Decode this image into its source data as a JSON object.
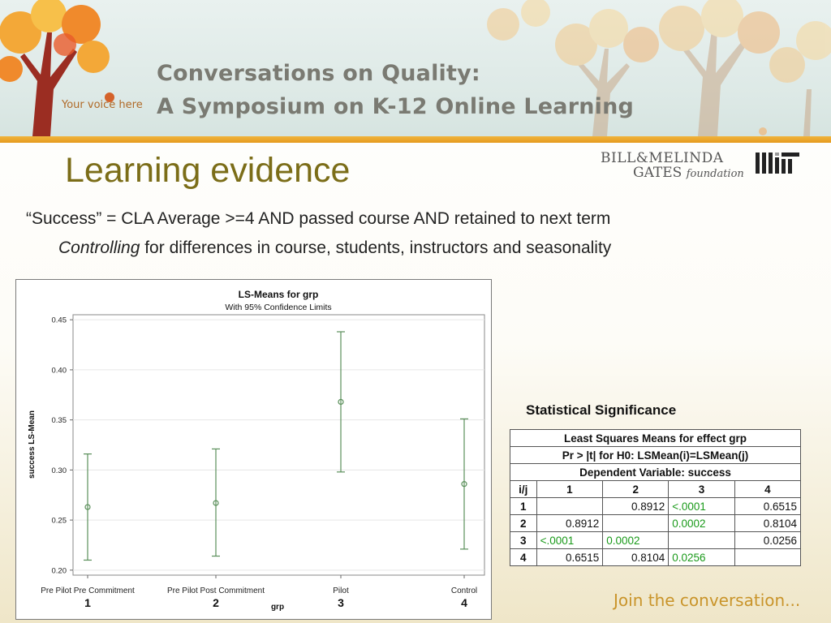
{
  "banner": {
    "title_line1": "Conversations on Quality:",
    "title_line2": "A Symposium on K-12 Online Learning",
    "voice": "Your voice here"
  },
  "slide": {
    "title": "Learning evidence",
    "line1": "“Success” = CLA Average >=4 AND passed course AND retained to next term",
    "line2_italic": "Controlling",
    "line2_rest": " for differences in course, students, instructors and seasonality"
  },
  "logos": {
    "gates_line1": "BILL&MELINDA",
    "gates_line2_a": "GATES",
    "gates_line2_b": "foundation",
    "mit": "MIT"
  },
  "chart_data": {
    "type": "scatter",
    "title": "LS-Means for grp",
    "subtitle": "With 95% Confidence Limits",
    "xlabel": "grp",
    "ylabel": "success LS-Mean",
    "ylim": [
      0.195,
      0.455
    ],
    "yticks": [
      "0.20",
      "0.25",
      "0.30",
      "0.35",
      "0.40",
      "0.45"
    ],
    "categories": [
      "Pre Pilot Pre Commitment",
      "Pre Pilot Post Commitment",
      "Pilot",
      "Control"
    ],
    "group_numbers": [
      "1",
      "2",
      "3",
      "4"
    ],
    "series": [
      {
        "values": [
          0.263,
          0.267,
          0.368,
          0.286
        ],
        "lower": [
          0.21,
          0.214,
          0.298,
          0.221
        ],
        "upper": [
          0.316,
          0.321,
          0.438,
          0.351
        ]
      }
    ],
    "color": "#5a8f5a",
    "grid": true
  },
  "table": {
    "heading": "Statistical Significance",
    "title1": "Least Squares Means for effect grp",
    "title2": "Pr > |t| for H0: LSMean(i)=LSMean(j)",
    "title3": "Dependent Variable: success",
    "corner": "i/j",
    "columns": [
      "1",
      "2",
      "3",
      "4"
    ],
    "rows": [
      {
        "label": "1",
        "cells": [
          "",
          "0.8912",
          "<.0001",
          "0.6515"
        ],
        "sig": [
          false,
          false,
          true,
          false
        ]
      },
      {
        "label": "2",
        "cells": [
          "0.8912",
          "",
          "0.0002",
          "0.8104"
        ],
        "sig": [
          false,
          false,
          true,
          false
        ]
      },
      {
        "label": "3",
        "cells": [
          "<.0001",
          "0.0002",
          "",
          "0.0256"
        ],
        "sig": [
          true,
          true,
          false,
          false
        ]
      },
      {
        "label": "4",
        "cells": [
          "0.6515",
          "0.8104",
          "0.0256",
          ""
        ],
        "sig": [
          false,
          false,
          true,
          false
        ]
      }
    ],
    "sig_color": "#1a9a1a"
  },
  "footer": {
    "join": "Join the conversation..."
  }
}
